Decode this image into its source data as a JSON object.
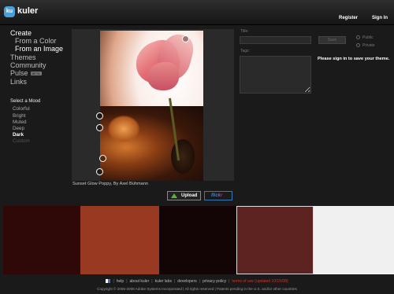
{
  "app": {
    "logo_badge": "ku",
    "name": "kuler"
  },
  "header": {
    "register": "Register",
    "signin": "Sign In"
  },
  "nav": {
    "create": "Create",
    "from_color": "From a Color",
    "from_image": "From an Image",
    "themes": "Themes",
    "community": "Community",
    "pulse": "Pulse",
    "pulse_badge": "BETA",
    "links": "Links"
  },
  "mood": {
    "heading": "Select a Mood",
    "options": [
      "Colorful",
      "Bright",
      "Muted",
      "Deep",
      "Dark",
      "Custom"
    ],
    "selected": "Dark"
  },
  "image": {
    "credit": "Sunset Glow Poppy, By Axel Bühmann",
    "upload_label": "Upload",
    "flickr_a": "flick",
    "flickr_b": "r"
  },
  "form": {
    "title_label": "Title:",
    "tags_label": "Tags:",
    "save_label": "Save",
    "public_label": "Public",
    "private_label": "Private",
    "signin_message": "Please sign in to save your theme."
  },
  "swatch_colors": [
    "#2f0808",
    "#983a22",
    "#130505",
    "#5d2320",
    "#f0f0f0"
  ],
  "selected_swatch": 3,
  "footer": {
    "links": [
      "help",
      "about kuler",
      "kuler labs",
      "developers",
      "privacy policy",
      "terms of use (updated 10/15/08)"
    ],
    "copyright": "Copyright © 2006-2008 Adobe Systems Incorporated | All rights reserved | Patents pending in the U.S. and/or other countries"
  }
}
